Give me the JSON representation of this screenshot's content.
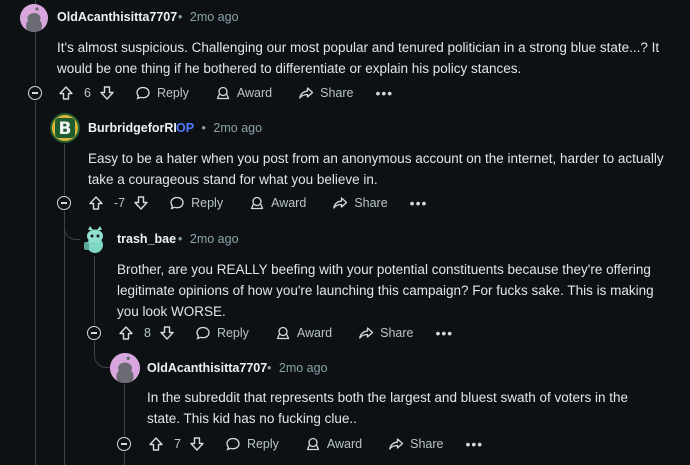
{
  "colors": {
    "background": "#0e1113",
    "op_badge": "#4f7cff",
    "text": "#e3e6e8",
    "meta": "#8ba2ad"
  },
  "comments": [
    {
      "username": "OldAcanthisitta7707",
      "age": "2mo ago",
      "separator": "•",
      "lines": [
        "It's almost suspicious. Challenging our most popular and tenured politician in a strong blue state...? It",
        "would be one thing if he bothered to differentiate or explain his policy stances."
      ],
      "score": "6",
      "reply_label": "Reply",
      "award_label": "Award",
      "share_label": "Share",
      "more_label": "•••"
    },
    {
      "username": "BurbridgeforRI",
      "op_label": "OP",
      "age": "2mo ago",
      "separator": "•",
      "lines": [
        "Easy to be a hater when you post from an anonymous account on the internet, harder to actually",
        "take a courageous stand for what you believe in."
      ],
      "score": "-7",
      "reply_label": "Reply",
      "award_label": "Award",
      "share_label": "Share",
      "more_label": "•••"
    },
    {
      "username": "trash_bae",
      "age": "2mo ago",
      "separator": "•",
      "lines": [
        "Brother, are you REALLY beefing with your potential constituents because they're offering",
        "legitimate opinions of how you're launching this campaign? For fucks sake. This is making",
        "you look WORSE."
      ],
      "score": "8",
      "reply_label": "Reply",
      "award_label": "Award",
      "share_label": "Share",
      "more_label": "•••"
    },
    {
      "username": "OldAcanthisitta7707",
      "age": "2mo ago",
      "separator": "•",
      "lines": [
        "In the subreddit that represents both the largest and bluest swath of voters in the",
        "state. This kid has no fucking clue.."
      ],
      "score": "7",
      "reply_label": "Reply",
      "award_label": "Award",
      "share_label": "Share",
      "more_label": "•••"
    }
  ],
  "icons": [
    "upvote-icon",
    "downvote-icon",
    "reply-icon",
    "award-icon",
    "share-icon",
    "collapse-icon",
    "snoo-avatar-icon",
    "campaign-logo-b-icon"
  ]
}
